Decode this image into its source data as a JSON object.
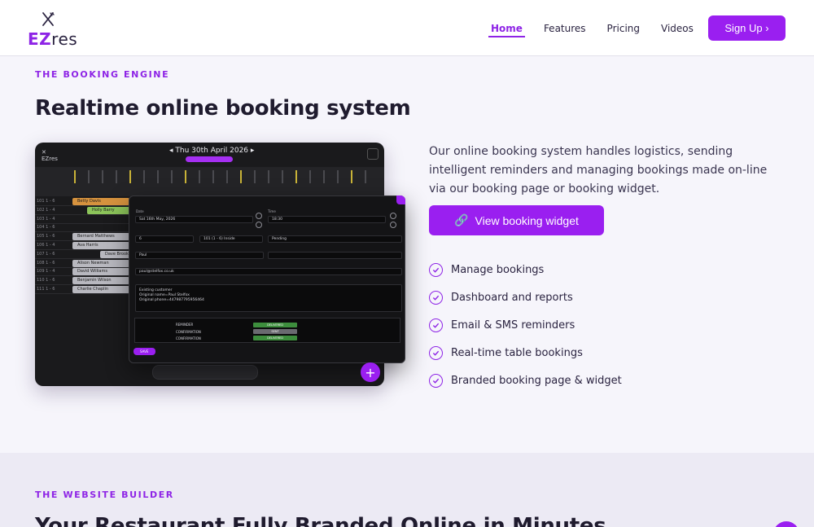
{
  "nav": {
    "logo_ez": "EZ",
    "logo_res": "res",
    "links": [
      "Home",
      "Features",
      "Pricing",
      "Videos"
    ],
    "signup": "Sign Up ›"
  },
  "hero": {
    "eyebrow": "THE BOOKING ENGINE",
    "title": "Realtime online booking system",
    "description": "Our online booking system handles logistics, sending intelligent reminders and managing bookings made on-line via our booking page or booking widget.",
    "cta": "View booking widget",
    "features": [
      "Manage bookings",
      "Dashboard and reports",
      "Email & SMS reminders",
      "Real-time table bookings",
      "Branded booking page & widget"
    ]
  },
  "mockup": {
    "date": "◂ Thu 30th April 2026 ▸",
    "rows": [
      {
        "label": "101  1 - 6",
        "bar": "Betty Davis"
      },
      {
        "label": "102  1 - 4",
        "bar": "Holly Barry"
      },
      {
        "label": "103  1 - 4",
        "bar": ""
      },
      {
        "label": "104  1 - 6",
        "bar": ""
      },
      {
        "label": "105  1 - 6",
        "bar": "Bernard Matthews"
      },
      {
        "label": "106  1 - 4",
        "bar": "Ava Harris"
      },
      {
        "label": "107  1 - 6",
        "bar": "Dave Brooks"
      },
      {
        "label": "108  1 - 6",
        "bar": "Alison Newman"
      },
      {
        "label": "109  1 - 4",
        "bar": "David Williams"
      },
      {
        "label": "110  1 - 6",
        "bar": "Benjamin Wilson"
      },
      {
        "label": "111  1 - 6",
        "bar": "Charlie Chaplin"
      }
    ],
    "modal_date": "Sat 16th May, 2026",
    "modal_time": "18:30",
    "modal_status": "Pending",
    "modal_name": "Paul",
    "modal_email": "paul@stelfox.co.uk",
    "notes_lines": [
      "Existing customer",
      "Original name=Paul Stelfox",
      "Original phone=447987795956464"
    ],
    "messages": [
      {
        "type": "REMINDER",
        "status": "DELIVERED"
      },
      {
        "type": "CONFIRMATION",
        "status": "SENT"
      },
      {
        "type": "CONFIRMATION",
        "status": "DELIVERED"
      }
    ],
    "save": "SAVE",
    "fab": "+"
  },
  "section2": {
    "eyebrow": "THE WEBSITE BUILDER",
    "title": "Your Restaurant Fully Branded Online in Minutes"
  },
  "colors": {
    "accent": "#9a1ff0",
    "heading": "#1f1b2e"
  }
}
